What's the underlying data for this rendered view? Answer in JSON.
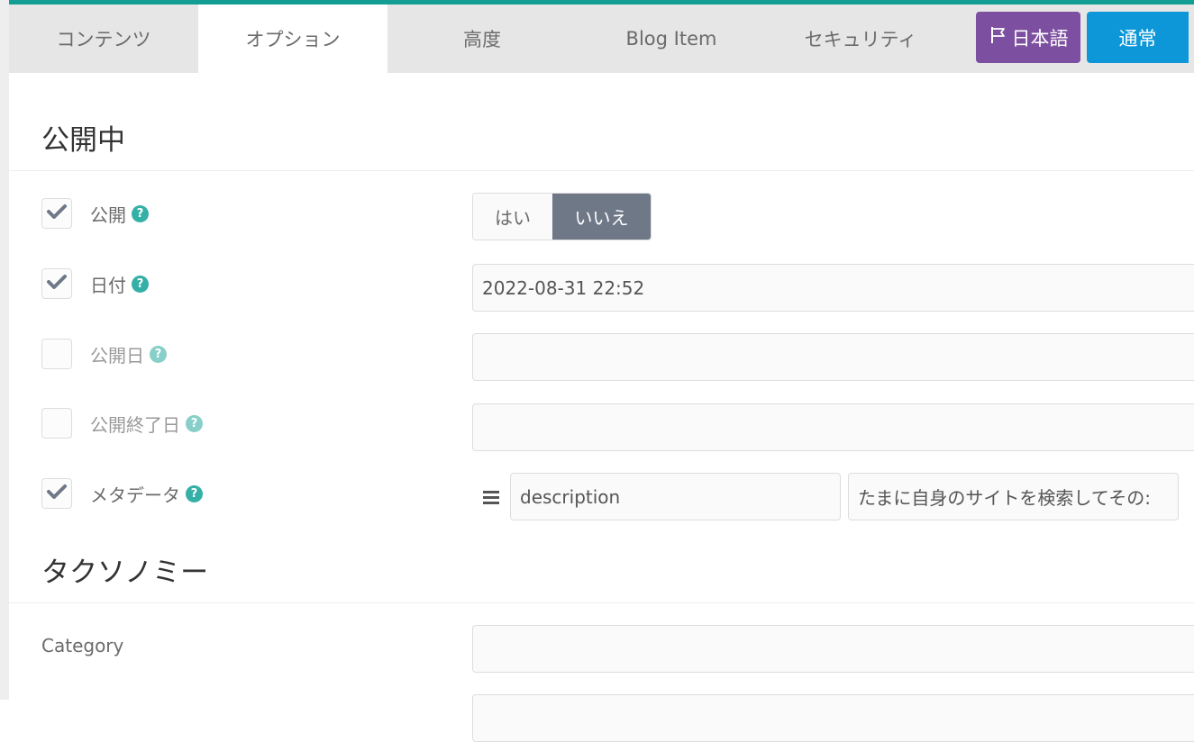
{
  "tabs": [
    {
      "label": "コンテンツ",
      "active": false
    },
    {
      "label": "オプション",
      "active": true
    },
    {
      "label": "高度",
      "active": false
    },
    {
      "label": "Blog Item",
      "active": false
    },
    {
      "label": "セキュリティ",
      "active": false
    }
  ],
  "toolbar": {
    "language_label": "日本語",
    "language_icon": "flag-icon",
    "mode_label": "通常"
  },
  "sections": {
    "publishing_title": "公開中",
    "taxonomy_title": "タクソノミー"
  },
  "fields": {
    "published": {
      "label": "公開",
      "checked": true,
      "options": [
        "はい",
        "いいえ"
      ],
      "selected": "いいえ"
    },
    "date": {
      "label": "日付",
      "checked": true,
      "value": "2022-08-31 22:52"
    },
    "publish_date": {
      "label": "公開日",
      "checked": false,
      "value": ""
    },
    "unpublish_date": {
      "label": "公開終了日",
      "checked": false,
      "value": ""
    },
    "metadata": {
      "label": "メタデータ",
      "checked": true,
      "key": "description",
      "value": "たまに自身のサイトを検索してその:"
    }
  },
  "taxonomy": {
    "category_label": "Category",
    "category_value": ""
  },
  "colors": {
    "accent_bar": "#129e94",
    "language_button": "#7c4fa0",
    "mode_button": "#0e97d8",
    "toggle_selected": "#6e7887",
    "help_icon": "#35b0a7"
  }
}
